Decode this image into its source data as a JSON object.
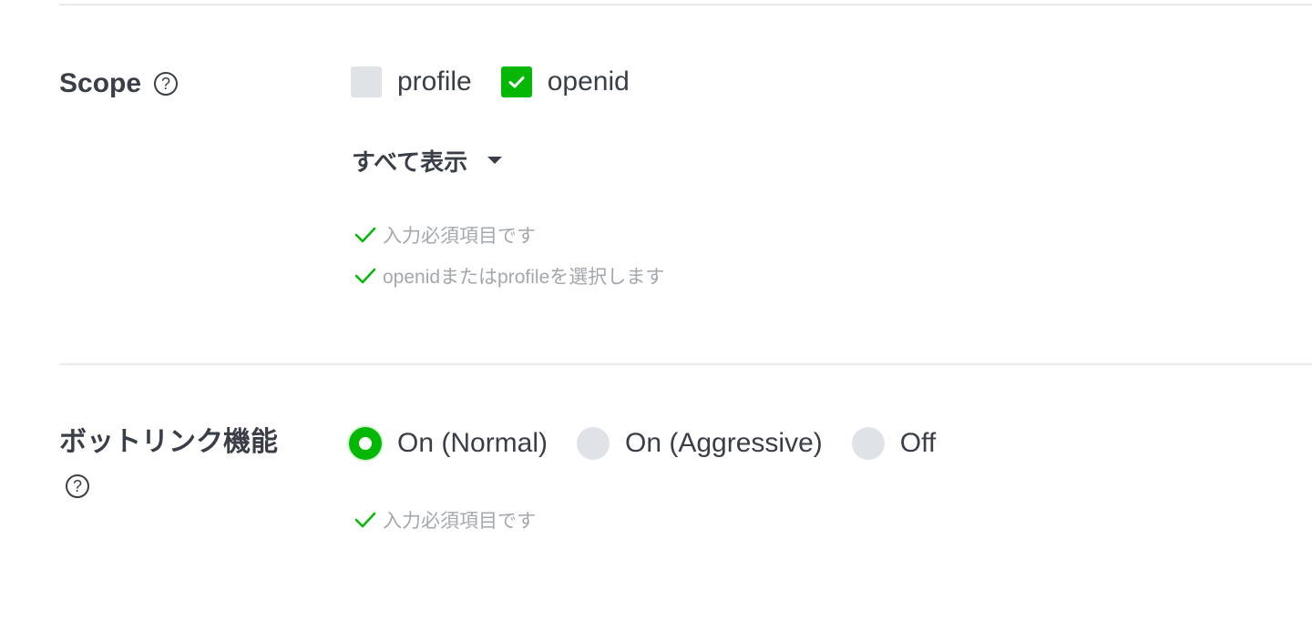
{
  "scope": {
    "label": "Scope",
    "help_symbol": "?",
    "options": [
      {
        "label": "profile",
        "checked": false
      },
      {
        "label": "openid",
        "checked": true
      }
    ],
    "show_all": "すべて表示",
    "validations": [
      "入力必須項目です",
      "openidまたはprofileを選択します"
    ]
  },
  "bot_link": {
    "label": "ボットリンク機能",
    "help_symbol": "?",
    "options": [
      {
        "label": "On (Normal)",
        "selected": true
      },
      {
        "label": "On (Aggressive)",
        "selected": false
      },
      {
        "label": "Off",
        "selected": false
      }
    ],
    "validations": [
      "入力必須項目です"
    ]
  },
  "colors": {
    "accent_green": "#06b806",
    "text": "#3a3f47",
    "muted": "#a3a8ae",
    "unchecked": "#dfe2e6"
  },
  "icons": {
    "help": "help-circle-icon",
    "check": "checkmark-icon",
    "caret": "caret-down-icon"
  }
}
